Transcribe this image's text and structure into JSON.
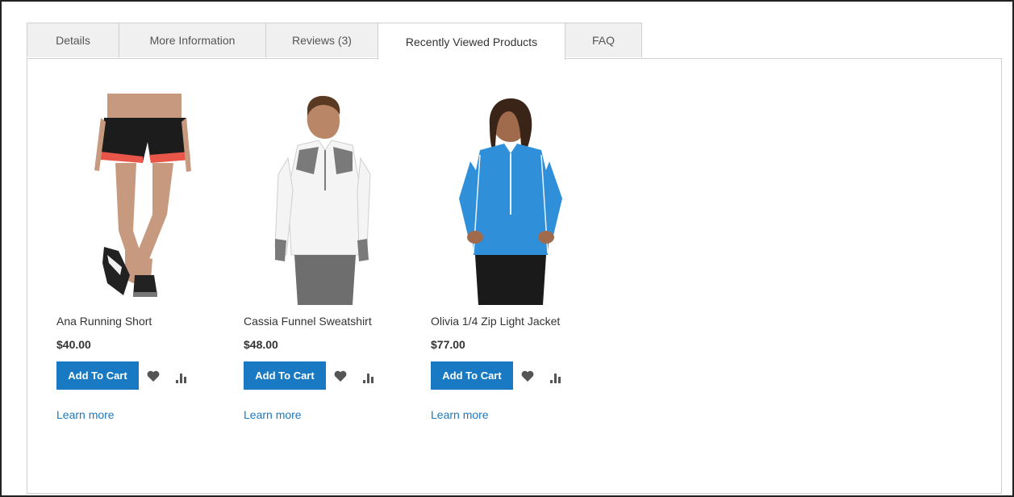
{
  "tabs": [
    {
      "label": "Details"
    },
    {
      "label": "More Information"
    },
    {
      "label": "Reviews (3)"
    },
    {
      "label": "Recently Viewed Products"
    },
    {
      "label": "FAQ"
    }
  ],
  "active_tab": "Recently Viewed Products",
  "products": [
    {
      "name": "Ana Running Short",
      "price": "$40.00",
      "add_to_cart": "Add To Cart",
      "learn_more": "Learn more"
    },
    {
      "name": "Cassia Funnel Sweatshirt",
      "price": "$48.00",
      "add_to_cart": "Add To Cart",
      "learn_more": "Learn more"
    },
    {
      "name": "Olivia 1/4 Zip Light Jacket",
      "price": "$77.00",
      "add_to_cart": "Add To Cart",
      "learn_more": "Learn more"
    }
  ],
  "icons": {
    "wishlist": "heart-icon",
    "compare": "compare-bars-icon"
  },
  "colors": {
    "accent": "#1979c3",
    "tab_bg": "#f0f0f0",
    "border": "#cfcfcf",
    "icon": "#555555"
  }
}
